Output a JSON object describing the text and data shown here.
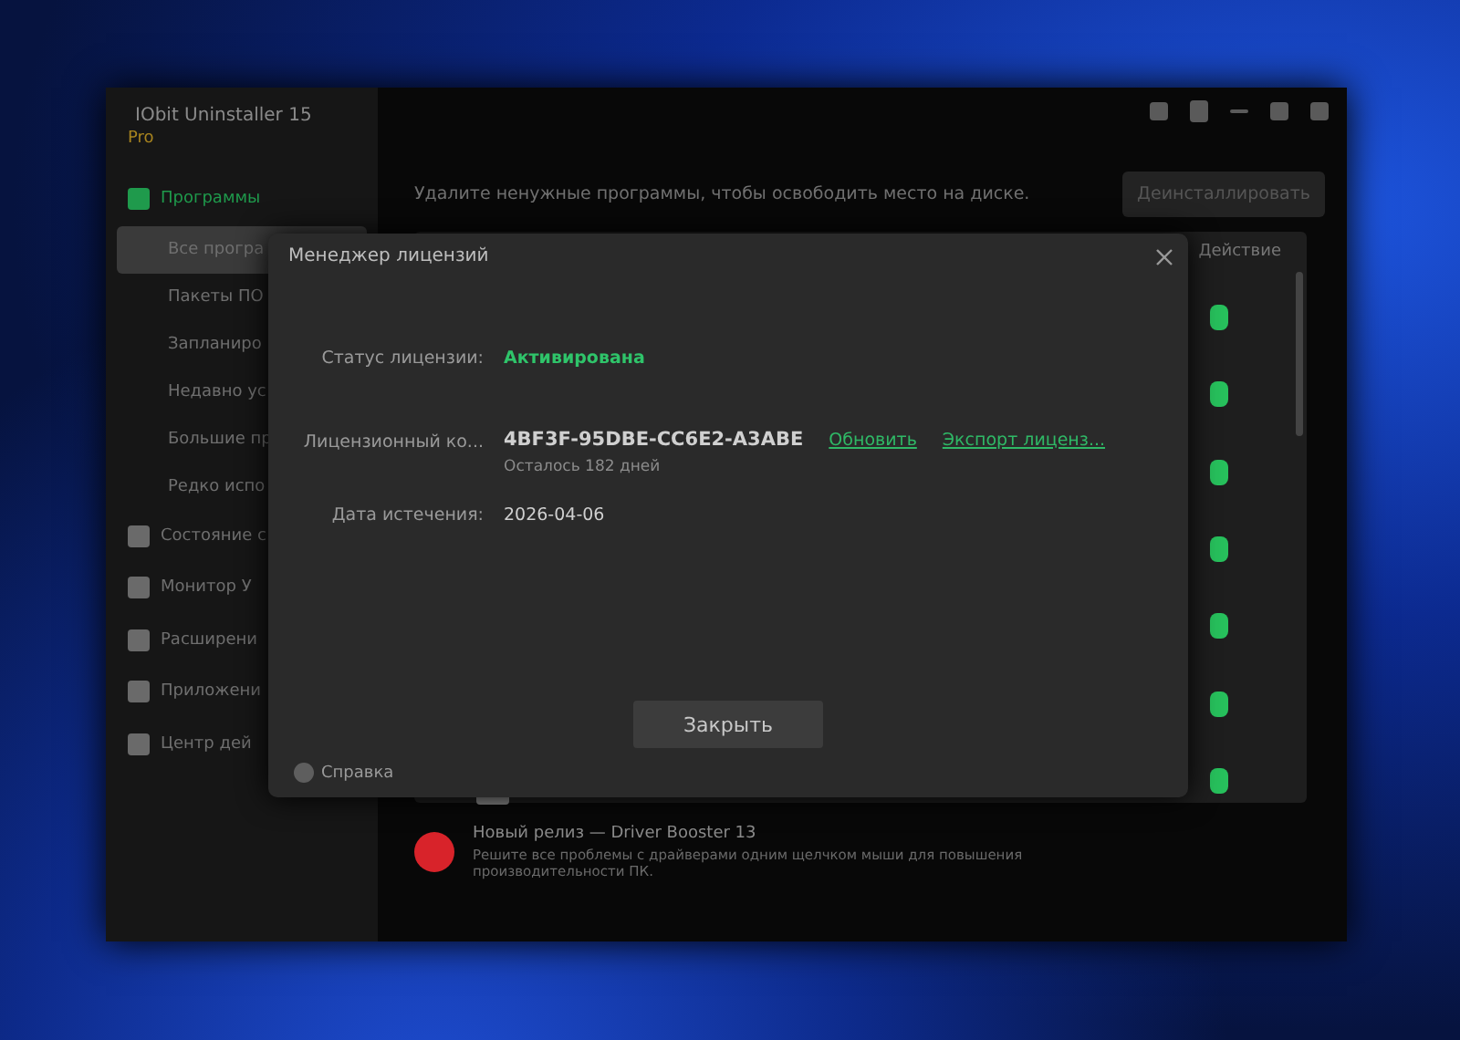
{
  "app": {
    "title": "IObit Uninstaller 15",
    "edition": "Pro"
  },
  "sidebar": {
    "items": [
      {
        "label": "Программы",
        "kind": "section",
        "selected": false
      },
      {
        "label": "Все програ",
        "kind": "sub",
        "selected": true
      },
      {
        "label": "Пакеты ПО",
        "kind": "sub",
        "selected": false
      },
      {
        "label": "Запланиро",
        "kind": "sub",
        "selected": false
      },
      {
        "label": "Недавно ус",
        "kind": "sub",
        "selected": false
      },
      {
        "label": "Большие пр",
        "kind": "sub",
        "selected": false
      },
      {
        "label": "Редко испо",
        "kind": "sub",
        "selected": false
      },
      {
        "label": "Состояние с",
        "kind": "section",
        "selected": false
      },
      {
        "label": "Монитор У",
        "kind": "section",
        "selected": false
      },
      {
        "label": "Расширени",
        "kind": "section",
        "selected": false
      },
      {
        "label": "Приложени",
        "kind": "section",
        "selected": false
      },
      {
        "label": "Центр дей",
        "kind": "section",
        "selected": false
      }
    ]
  },
  "main": {
    "hint": "Удалите ненужные программы, чтобы освободить место на диске.",
    "action_button": "Деинсталлировать",
    "table": {
      "column_action": "Действие",
      "rows": [
        {
          "on": true
        },
        {
          "on": true
        },
        {
          "on": true
        },
        {
          "on": true
        },
        {
          "on": true
        },
        {
          "on": true
        },
        {
          "on": true
        }
      ]
    },
    "promo": {
      "title": "Новый релиз — Driver Booster 13",
      "text": "Решите все проблемы с драйверами одним щелчком мыши для повышения производительности ПК."
    }
  },
  "dialog": {
    "title": "Менеджер лицензий",
    "status": {
      "label": "Статус лицензии:",
      "value": "Активирована"
    },
    "key": {
      "label": "Лицензионный ко...",
      "value": "4BF3F-95DBE-CC6E2-A3ABE",
      "remaining": "Осталось 182 дней",
      "links": [
        "Обновить",
        "Экспорт лиценз..."
      ]
    },
    "expiry": {
      "label": "Дата истечения:",
      "value": "2026-04-06"
    },
    "close_button": "Закрыть",
    "help": "Справка"
  }
}
